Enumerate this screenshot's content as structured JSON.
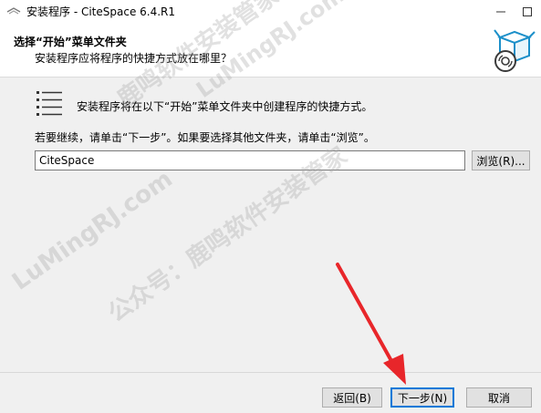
{
  "window": {
    "title": "安装程序 - CiteSpace 6.4.R1",
    "app_icon": "installer-icon",
    "minimize_icon": "minimize-icon",
    "maximize_icon": "maximize-icon"
  },
  "header": {
    "title": "选择“开始”菜单文件夹",
    "subtitle": "安装程序应将程序的快捷方式放在哪里？",
    "icon": "software-box-cd-icon"
  },
  "main": {
    "list_icon": "list-icon",
    "description": "安装程序将在以下“开始”菜单文件夹中创建程序的快捷方式。",
    "continue_text": "若要继续，请单击“下一步”。如果要选择其他文件夹，请单击“浏览”。",
    "folder_value": "CiteSpace",
    "browse_label": "浏览(R)..."
  },
  "footer": {
    "back_label": "返回(B)",
    "next_label": "下一步(N)",
    "cancel_label": "取消"
  },
  "watermark": {
    "text_1": "公众号：鹿鸣软件安装管家",
    "text_2": "LuMingRJ.com",
    "text_3": "鹿鸣软件安装管家",
    "text_4": "LuMingRJ.com",
    "color": "#aaaaaa"
  },
  "annotation": {
    "arrow_color": "#e8262a"
  },
  "colors": {
    "focus_border": "#0078d7",
    "button_face": "#e1e1e1",
    "dialog_bg": "#f0f0f0"
  }
}
